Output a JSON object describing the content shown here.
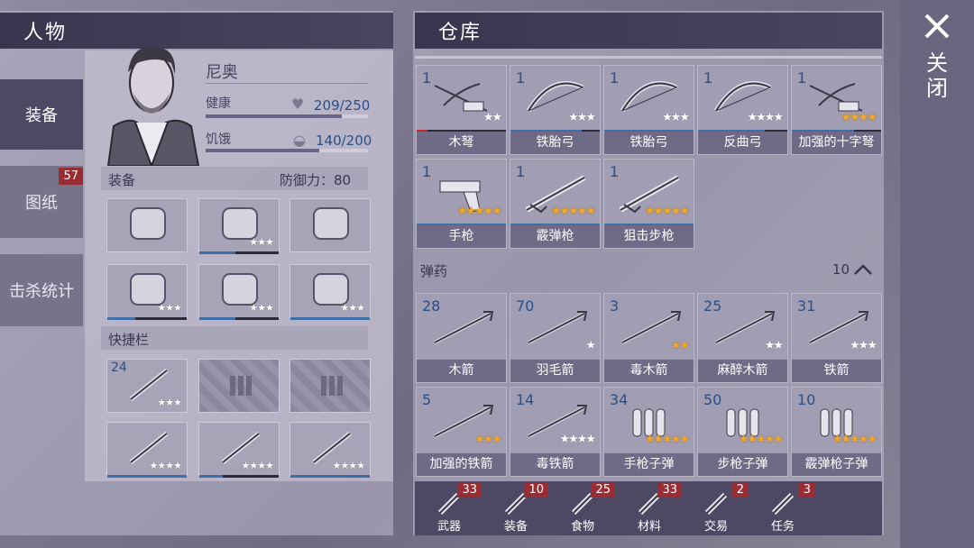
{
  "left": {
    "header": "人物",
    "nav": [
      {
        "label": "装备",
        "active": true
      },
      {
        "label": "图纸",
        "badge": "57"
      },
      {
        "label": "击杀统计"
      }
    ],
    "character": {
      "name": "尼奥",
      "health_label": "健康",
      "health_value": "209/250",
      "hunger_label": "饥饿",
      "hunger_value": "140/200"
    },
    "equipment": {
      "title": "装备",
      "defense": "防御力：80",
      "slots": [
        {
          "icon": "beanie-icon",
          "stars": 0,
          "bar": 0
        },
        {
          "icon": "vest-icon",
          "stars": 3,
          "bar": 0.45
        },
        {
          "icon": "jacket-icon",
          "stars": 0,
          "bar": 0
        },
        {
          "icon": "gloves-icon",
          "stars": 3,
          "bar": 0.35
        },
        {
          "icon": "shorts-icon",
          "stars": 3,
          "bar": 0.45
        },
        {
          "icon": "shoes-icon",
          "stars": 3,
          "bar": 1.0
        }
      ]
    },
    "quickbar": {
      "title": "快捷栏",
      "slots": [
        {
          "icon": "fire-arrow-icon",
          "count": "24",
          "stars": 3
        },
        {
          "icon": "empty-slot-icon"
        },
        {
          "icon": "empty-slot-icon"
        },
        {
          "icon": "pickaxe-icon",
          "stars": 4,
          "bar": 1.0
        },
        {
          "icon": "baton-icon",
          "stars": 4,
          "bar": 0.3
        },
        {
          "icon": "axe-icon",
          "stars": 4,
          "bar": 1.0
        }
      ]
    }
  },
  "right": {
    "header": "仓库",
    "weapons": [
      {
        "count": "1",
        "label": "木弩",
        "stars": 2,
        "gold": false,
        "bar": 0.12,
        "bar_color": "#c0282c",
        "icon": "crossbow-icon"
      },
      {
        "count": "1",
        "label": "铁胎弓",
        "stars": 3,
        "gold": false,
        "bar": 0.8,
        "bar_color": "#3e6fa6",
        "icon": "bow-icon"
      },
      {
        "count": "1",
        "label": "铁胎弓",
        "stars": 3,
        "gold": false,
        "bar": 1.0,
        "bar_color": "#3e6fa6",
        "icon": "bow-icon"
      },
      {
        "count": "1",
        "label": "反曲弓",
        "stars": 4,
        "gold": false,
        "bar": 0.75,
        "bar_color": "#3e6fa6",
        "icon": "recurve-bow-icon"
      },
      {
        "count": "1",
        "label": "加强的十字弩",
        "stars": 4,
        "gold": true,
        "bar": 0.7,
        "bar_color": "#3e6fa6",
        "icon": "crossbow-icon"
      },
      {
        "count": "1",
        "label": "手枪",
        "stars": 5,
        "gold": true,
        "bar": 1.0,
        "bar_color": "#3e6fa6",
        "icon": "revolver-icon"
      },
      {
        "count": "1",
        "label": "霰弹枪",
        "stars": 5,
        "gold": true,
        "bar": 1.0,
        "bar_color": "#3e6fa6",
        "icon": "shotgun-icon"
      },
      {
        "count": "1",
        "label": "狙击步枪",
        "stars": 5,
        "gold": true,
        "bar": 1.0,
        "bar_color": "#3e6fa6",
        "icon": "sniper-rifle-icon"
      }
    ],
    "ammo_section": {
      "title": "弹药",
      "count": "10"
    },
    "ammo": [
      {
        "count": "28",
        "label": "木箭",
        "stars": 0,
        "gold": false,
        "icon": "wood-arrow-icon"
      },
      {
        "count": "70",
        "label": "羽毛箭",
        "stars": 1,
        "gold": false,
        "icon": "feather-arrow-icon"
      },
      {
        "count": "3",
        "label": "毒木箭",
        "stars": 2,
        "gold": true,
        "icon": "poison-arrow-icon"
      },
      {
        "count": "25",
        "label": "麻醉木箭",
        "stars": 2,
        "gold": false,
        "icon": "tranq-arrow-icon"
      },
      {
        "count": "31",
        "label": "铁箭",
        "stars": 3,
        "gold": false,
        "icon": "iron-arrow-icon"
      },
      {
        "count": "5",
        "label": "加强的铁箭",
        "stars": 3,
        "gold": true,
        "icon": "iron-arrow-icon"
      },
      {
        "count": "14",
        "label": "毒铁箭",
        "stars": 4,
        "gold": false,
        "icon": "poison-arrow-icon"
      },
      {
        "count": "34",
        "label": "手枪子弹",
        "stars": 5,
        "gold": true,
        "icon": "pistol-ammo-icon"
      },
      {
        "count": "50",
        "label": "步枪子弹",
        "stars": 5,
        "gold": true,
        "icon": "rifle-ammo-icon"
      },
      {
        "count": "10",
        "label": "霰弹枪子弹",
        "stars": 5,
        "gold": true,
        "icon": "shotgun-ammo-icon"
      }
    ],
    "tabs": [
      {
        "label": "武器",
        "badge": "33",
        "icon": "axe-tab-icon"
      },
      {
        "label": "装备",
        "badge": "10",
        "icon": "shirt-tab-icon"
      },
      {
        "label": "食物",
        "badge": "25",
        "icon": "meat-tab-icon"
      },
      {
        "label": "材料",
        "badge": "33",
        "icon": "material-tab-icon"
      },
      {
        "label": "交易",
        "badge": "2",
        "icon": "coin-tab-icon"
      },
      {
        "label": "任务",
        "badge": "3",
        "icon": "key-tab-icon"
      }
    ]
  },
  "close": {
    "label": "关闭"
  }
}
